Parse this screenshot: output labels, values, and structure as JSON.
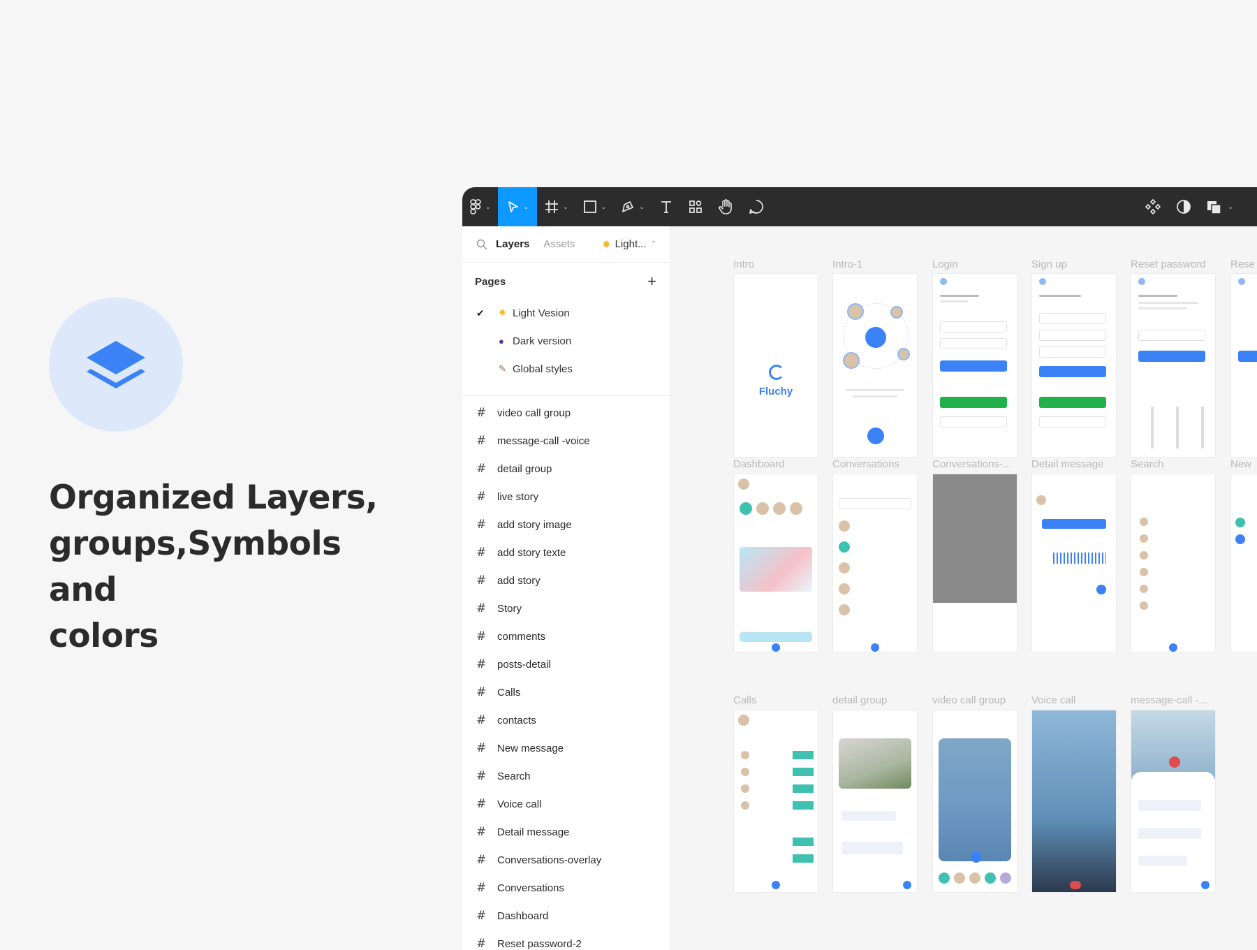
{
  "promo": {
    "headline_line1": "Organized Layers,",
    "headline_line2": "groups,Symbols and",
    "headline_line3": "colors",
    "icon": "layers-icon",
    "icon_color": "#3b82f6",
    "badge_color": "#dde9fb"
  },
  "toolbar": {
    "items": [
      "figma-menu-icon",
      "move-tool-icon",
      "frame-tool-icon",
      "shape-tool-icon",
      "pen-tool-icon",
      "text-tool-icon",
      "resources-icon",
      "hand-tool-icon",
      "comment-tool-icon"
    ],
    "right_items": [
      "components-icon",
      "theme-toggle-icon",
      "layers-style-icon"
    ],
    "active_color": "#0d99ff"
  },
  "panel": {
    "tab_layers": "Layers",
    "tab_assets": "Assets",
    "page_picker": "Light...",
    "pages_label": "Pages",
    "pages": [
      {
        "label": "Light Vesion",
        "glyph": "sun-icon",
        "checked": true
      },
      {
        "label": "Dark version",
        "glyph": "moon-icon",
        "checked": false
      },
      {
        "label": "Global styles",
        "glyph": "brush-icon",
        "checked": false
      }
    ],
    "layers": [
      "video call group",
      "message-call -voice",
      "detail group",
      "live story",
      "add story image",
      "add story texte",
      "add story",
      "Story",
      "comments",
      "posts-detail",
      "Calls",
      "contacts",
      "New message",
      "Search",
      "Voice call",
      "Detail message",
      "Conversations-overlay",
      "Conversations",
      "Dashboard",
      "Reset password-2"
    ]
  },
  "canvas": {
    "row1_labels": [
      "Intro",
      "Intro-1",
      "Login",
      "Sign up",
      "Reset password",
      "Rese"
    ],
    "row2_labels": [
      "Dashboard",
      "Conversations",
      "Conversations-...",
      "Detail message",
      "Search",
      "New"
    ],
    "row3_labels": [
      "Calls",
      "detail group",
      "video call group",
      "Voice call",
      "message-call -..."
    ],
    "intro_brand": "Fluchy",
    "accent": "#3b82f6",
    "green": "#22b04a",
    "teal": "#3fc1b0"
  }
}
